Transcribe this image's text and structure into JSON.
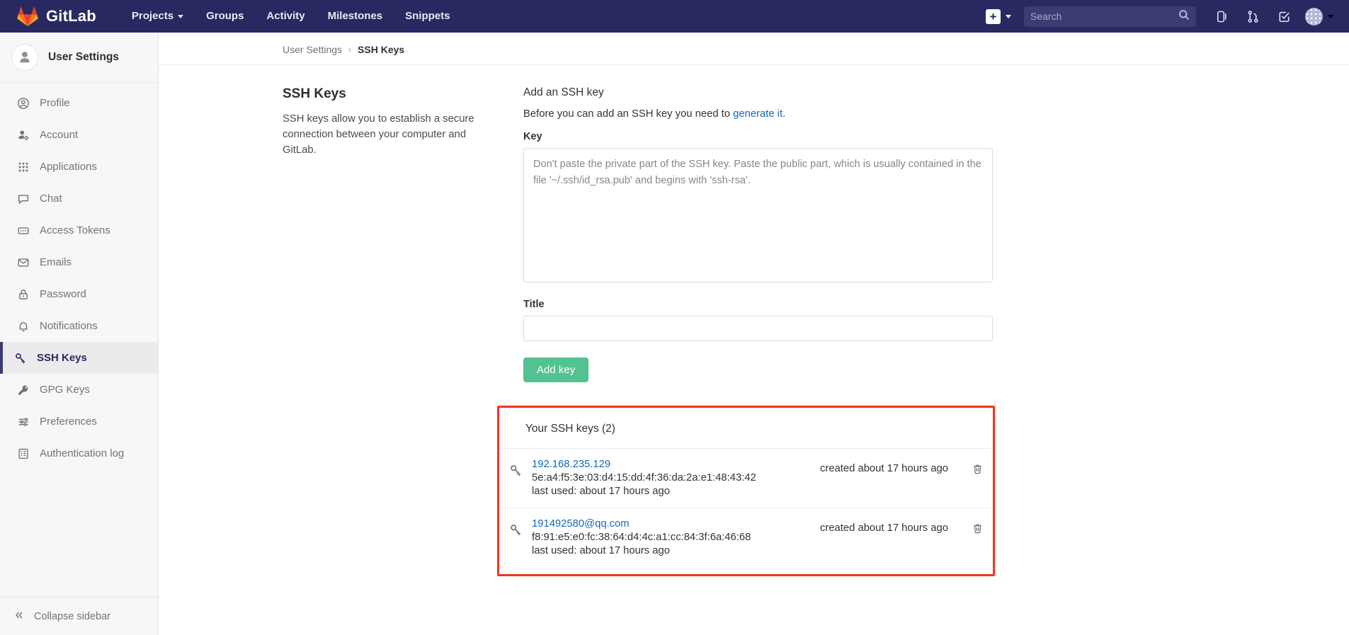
{
  "navbar": {
    "brand": "GitLab",
    "links": [
      {
        "label": "Projects",
        "has_caret": true
      },
      {
        "label": "Groups",
        "has_caret": false
      },
      {
        "label": "Activity",
        "has_caret": false
      },
      {
        "label": "Milestones",
        "has_caret": false
      },
      {
        "label": "Snippets",
        "has_caret": false
      }
    ],
    "plus_label": "+",
    "search_placeholder": "Search",
    "search_value": "",
    "icons": [
      "issues-icon",
      "merge-requests-icon",
      "todos-icon"
    ]
  },
  "sidebar": {
    "title": "User Settings",
    "items": [
      {
        "label": "Profile",
        "icon": "profile-icon",
        "active": false
      },
      {
        "label": "Account",
        "icon": "account-icon",
        "active": false
      },
      {
        "label": "Applications",
        "icon": "applications-icon",
        "active": false
      },
      {
        "label": "Chat",
        "icon": "chat-icon",
        "active": false
      },
      {
        "label": "Access Tokens",
        "icon": "access-tokens-icon",
        "active": false
      },
      {
        "label": "Emails",
        "icon": "emails-icon",
        "active": false
      },
      {
        "label": "Password",
        "icon": "password-icon",
        "active": false
      },
      {
        "label": "Notifications",
        "icon": "notifications-icon",
        "active": false
      },
      {
        "label": "SSH Keys",
        "icon": "ssh-keys-icon",
        "active": true
      },
      {
        "label": "GPG Keys",
        "icon": "gpg-keys-icon",
        "active": false
      },
      {
        "label": "Preferences",
        "icon": "preferences-icon",
        "active": false
      },
      {
        "label": "Authentication log",
        "icon": "authentication-log-icon",
        "active": false
      }
    ],
    "collapse_label": "Collapse sidebar"
  },
  "breadcrumb": {
    "parent": "User Settings",
    "separator": "›",
    "current": "SSH Keys"
  },
  "page": {
    "heading": "SSH Keys",
    "description": "SSH keys allow you to establish a secure connection between your computer and GitLab."
  },
  "form": {
    "section_title": "Add an SSH key",
    "intro_prefix": "Before you can add an SSH key you need to ",
    "intro_link": "generate it",
    "intro_suffix": ".",
    "key_label": "Key",
    "key_placeholder": "Don't paste the private part of the SSH key. Paste the public part, which is usually contained in the file '~/.ssh/id_rsa.pub' and begins with 'ssh-rsa'.",
    "key_value": "",
    "title_label": "Title",
    "title_placeholder": "",
    "title_value": "",
    "submit_label": "Add key"
  },
  "keys": {
    "heading": "Your SSH keys (2)",
    "count": 2,
    "highlight_color": "#f4351f",
    "items": [
      {
        "title": "192.168.235.129",
        "fingerprint": "5e:a4:f5:3e:03:d4:15:dd:4f:36:da:2a:e1:48:43:42",
        "last_used": "last used: about 17 hours ago",
        "created": "created about 17 hours ago",
        "delete_icon": "trash-icon"
      },
      {
        "title": "191492580@qq.com",
        "fingerprint": "f8:91:e5:e0:fc:38:64:d4:4c:a1:cc:84:3f:6a:46:68",
        "last_used": "last used: about 17 hours ago",
        "created": "created about 17 hours ago",
        "delete_icon": "trash-icon"
      }
    ]
  },
  "colors": {
    "navbar_bg": "#292961",
    "accent_blue": "#1068bf",
    "button_green": "#52c291",
    "highlight_red": "#f4351f"
  }
}
